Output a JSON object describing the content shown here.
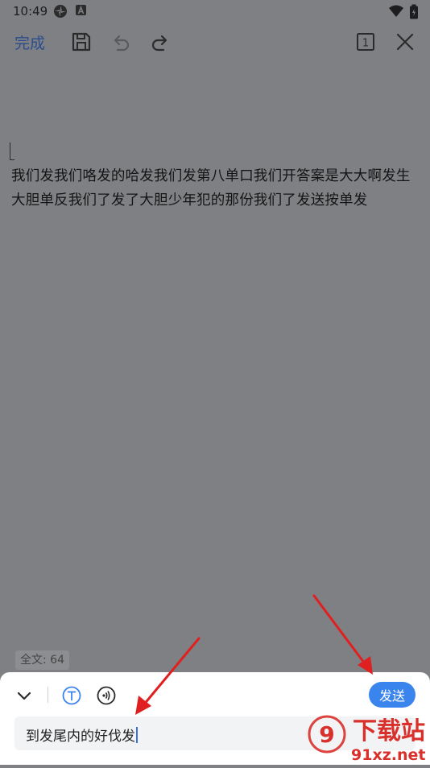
{
  "status_bar": {
    "time": "10:49",
    "icons": [
      "pinwheel-icon",
      "a-badge-icon",
      "wifi-icon",
      "battery-icon"
    ]
  },
  "toolbar": {
    "done_label": "完成",
    "page_count": "1",
    "icons": [
      "save-icon",
      "undo-icon",
      "redo-icon",
      "page-count-icon",
      "close-icon"
    ]
  },
  "document": {
    "lines": [
      "我们发我们咯发的哈发我们发第八单口我们开答案是大大啊发生",
      "大胆单反我们了发了大胆少年犯的那份我们了发送按单发"
    ]
  },
  "word_count": "全文: 64",
  "input_panel": {
    "send_label": "发送",
    "input_value": "到发尾内的好伐发",
    "icons": [
      "chevron-down-icon",
      "text-format-icon",
      "voice-input-icon"
    ]
  },
  "watermark": {
    "brand_text": "下载站",
    "domain_text": "91xz.net"
  },
  "colors": {
    "accent": "#3a84ee",
    "overlay": "#7f8083",
    "annotation_arrow": "#e02020"
  }
}
